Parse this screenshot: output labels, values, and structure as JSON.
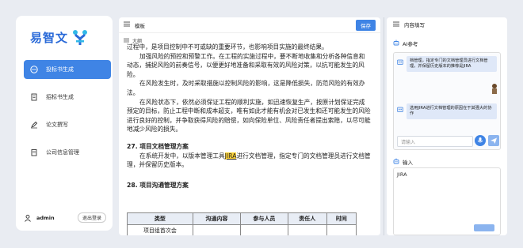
{
  "sidebar": {
    "logo_text": "易智文",
    "items": [
      {
        "label": "投标书生成",
        "active": true
      },
      {
        "label": "招标书生成",
        "active": false
      },
      {
        "label": "论文撰写",
        "active": false
      },
      {
        "label": "公司信息管理",
        "active": false
      }
    ],
    "user_name": "admin",
    "logout_label": "退出登录"
  },
  "main": {
    "header_title": "模板",
    "save_label": "保存",
    "outline_label": "大纲",
    "paragraphs": [
      "过程中，是项目控制中不可或缺的重要环节，也影响项目实施的最终结果。",
      "加强风险的预控和预警工作。在工程的实施过程中，要不断地收集和分析各种信息和动态，捕捉风险的前奏信号，以便更好地准备和采取有效的风险对策，以抗可能发生的风险。",
      "在风险发生时，及时采取措施以控制风险的影响，这是降低损失，防范风险的有效办法。",
      "在风险状态下，依然必须保证工程的顺利实施，如迅速恢复生产，按原计划保证完成预定的目标，防止工程中断和成本超支，唯有如此才能有机会对已发生和还可能发生的风险进行良好的控制，并争取获得风险的赔偿，如向保险单位、风险责任者提出索赔，以尽可能地减少风险的损失。"
    ],
    "section27": "27. 项目文档管理方案",
    "para27_before": "在系统开发中，以版本管理工具",
    "para27_highlight": "JIRA",
    "para27_after": "进行文档管理，指定专门的文档管理员进行文档管理，并保留历史版本。",
    "section28": "28. 项目沟通管理方案",
    "table_headers": [
      "类型",
      "沟通内容",
      "参与人员",
      "责任人",
      "时间"
    ],
    "table_rows": [
      [
        "项目组首次会",
        "",
        "",
        "",
        ""
      ]
    ]
  },
  "right": {
    "header_title": "内容填写",
    "ai_ref_label": "AI参考",
    "messages": [
      {
        "role": "sys",
        "text": "档管理，指定专门的文档管理员进行文档管理，并保留历史版本的推荐是JIRA"
      },
      {
        "role": "user",
        "text": "为什么选用这个，有什么好处吗"
      },
      {
        "role": "sys",
        "text": "选用JIRA进行文档管理的原因在于其强大的协作"
      }
    ],
    "chat_placeholder": "请输入",
    "input_label": "输入",
    "input_value": "JIRA"
  }
}
